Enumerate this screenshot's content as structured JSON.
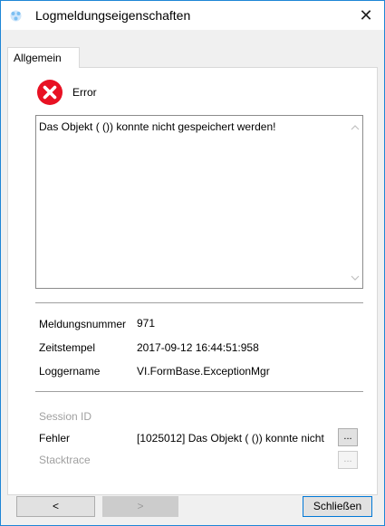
{
  "window": {
    "title": "Logmeldungseigenschaften",
    "close_glyph": "✕"
  },
  "tabs": [
    {
      "label": "Allgemein",
      "active": true
    }
  ],
  "message": {
    "level": "Error",
    "text": "Das Objekt ( ()) konnte nicht gespeichert werden!"
  },
  "details": {
    "number_label": "Meldungsnummer",
    "number_value": "971",
    "timestamp_label": "Zeitstempel",
    "timestamp_value": "2017-09-12 16:44:51:958",
    "logger_label": "Loggername",
    "logger_value": "VI.FormBase.ExceptionMgr"
  },
  "exception": {
    "session_label": "Session ID",
    "error_label": "Fehler",
    "error_value": "[1025012] Das Objekt ( ()) konnte nicht",
    "stacktrace_label": "Stacktrace",
    "more_glyph": "..."
  },
  "buttons": {
    "prev": "<",
    "next": ">",
    "close": "Schließen"
  },
  "colors": {
    "error_red": "#e81123",
    "accent_blue": "#0078d7"
  },
  "icons": {
    "app": "log-properties-icon",
    "error": "error-icon",
    "close": "close-icon"
  }
}
